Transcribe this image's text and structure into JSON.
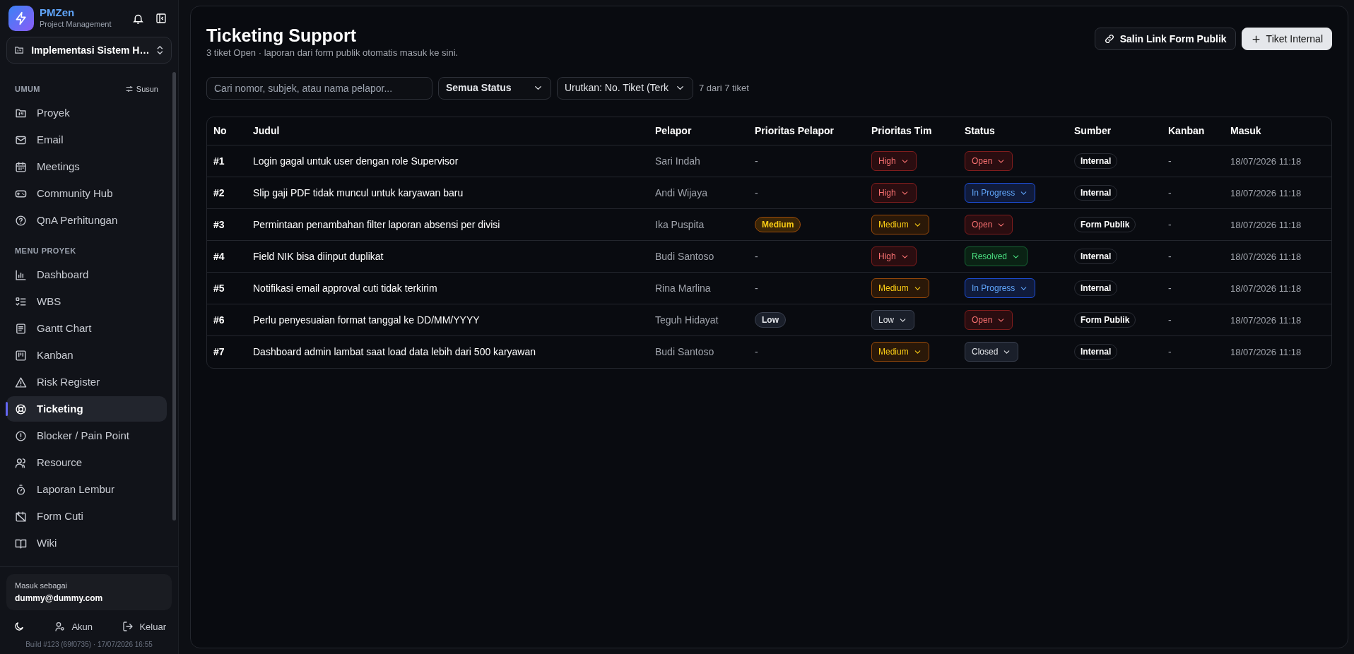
{
  "app": {
    "name": "PMZen",
    "subtitle": "Project Management"
  },
  "project_selector": {
    "value": "Implementasi Sistem H…"
  },
  "sidebar": {
    "sections": [
      {
        "title": "UMUM",
        "action": "Susun",
        "items": [
          {
            "label": "Proyek",
            "selected": false
          },
          {
            "label": "Email",
            "selected": false
          },
          {
            "label": "Meetings",
            "selected": false
          },
          {
            "label": "Community Hub",
            "selected": false
          },
          {
            "label": "QnA Perhitungan",
            "selected": false
          }
        ]
      },
      {
        "title": "MENU PROYEK",
        "items": [
          {
            "label": "Dashboard",
            "selected": false
          },
          {
            "label": "WBS",
            "selected": false
          },
          {
            "label": "Gantt Chart",
            "selected": false
          },
          {
            "label": "Kanban",
            "selected": false
          },
          {
            "label": "Risk Register",
            "selected": false
          },
          {
            "label": "Ticketing",
            "selected": true
          },
          {
            "label": "Blocker / Pain Point",
            "selected": false
          },
          {
            "label": "Resource",
            "selected": false
          },
          {
            "label": "Laporan Lembur",
            "selected": false
          },
          {
            "label": "Form Cuti",
            "selected": false
          },
          {
            "label": "Wiki",
            "selected": false
          }
        ]
      }
    ]
  },
  "user": {
    "caption": "Masuk sebagai",
    "email": "dummy@dummy.com"
  },
  "footer_actions": [
    "Akun",
    "Keluar"
  ],
  "build": "Build #123 (69f0735) · 17/07/2026 16:55",
  "page": {
    "title": "Ticketing Support",
    "subtitle": "3 tiket Open · laporan dari form publik otomatis masuk ke sini.",
    "buttons": [
      {
        "label": "Salin Link Form Publik",
        "kind": "link"
      },
      {
        "label": "Tiket Internal",
        "kind": "add"
      }
    ]
  },
  "filters": {
    "search": {
      "placeholder": "Cari nomor, subjek, atau nama pelapor..."
    },
    "status": "Semua Status",
    "sort": "Urutkan: No. Tiket (Terk",
    "count": "7 dari 7 tiket"
  },
  "table": {
    "columns": [
      "No",
      "Judul",
      "Pelapor",
      "Prioritas Pelapor",
      "Prioritas Tim",
      "Status",
      "Sumber",
      "Kanban",
      "Masuk"
    ],
    "rows": [
      {
        "no": "#1",
        "title": "Login gagal untuk user dengan role Supervisor",
        "reporter": "Sari Indah",
        "reporter_priority": {
          "kind": "none",
          "label": "-"
        },
        "team_priority": {
          "kind": "high",
          "label": "High"
        },
        "status": {
          "kind": "open",
          "label": "Open"
        },
        "source": "Internal",
        "kanban": "-",
        "date": "18/07/2026 11:18"
      },
      {
        "no": "#2",
        "title": "Slip gaji PDF tidak muncul untuk karyawan baru",
        "reporter": "Andi Wijaya",
        "reporter_priority": {
          "kind": "none",
          "label": "-"
        },
        "team_priority": {
          "kind": "high",
          "label": "High"
        },
        "status": {
          "kind": "progress",
          "label": "In Progress"
        },
        "source": "Internal",
        "kanban": "-",
        "date": "18/07/2026 11:18"
      },
      {
        "no": "#3",
        "title": "Permintaan penambahan filter laporan absensi per divisi",
        "reporter": "Ika Puspita",
        "reporter_priority": {
          "kind": "medium",
          "label": "Medium"
        },
        "team_priority": {
          "kind": "medium",
          "label": "Medium"
        },
        "status": {
          "kind": "open",
          "label": "Open"
        },
        "source": "Form Publik",
        "kanban": "-",
        "date": "18/07/2026 11:18"
      },
      {
        "no": "#4",
        "title": "Field NIK bisa diinput duplikat",
        "reporter": "Budi Santoso",
        "reporter_priority": {
          "kind": "none",
          "label": "-"
        },
        "team_priority": {
          "kind": "high",
          "label": "High"
        },
        "status": {
          "kind": "resolved",
          "label": "Resolved"
        },
        "source": "Internal",
        "kanban": "-",
        "date": "18/07/2026 11:18"
      },
      {
        "no": "#5",
        "title": "Notifikasi email approval cuti tidak terkirim",
        "reporter": "Rina Marlina",
        "reporter_priority": {
          "kind": "none",
          "label": "-"
        },
        "team_priority": {
          "kind": "medium",
          "label": "Medium"
        },
        "status": {
          "kind": "progress",
          "label": "In Progress"
        },
        "source": "Internal",
        "kanban": "-",
        "date": "18/07/2026 11:18"
      },
      {
        "no": "#6",
        "title": "Perlu penyesuaian format tanggal ke DD/MM/YYYY",
        "reporter": "Teguh Hidayat",
        "reporter_priority": {
          "kind": "low",
          "label": "Low"
        },
        "team_priority": {
          "kind": "low",
          "label": "Low"
        },
        "status": {
          "kind": "open",
          "label": "Open"
        },
        "source": "Form Publik",
        "kanban": "-",
        "date": "18/07/2026 11:18"
      },
      {
        "no": "#7",
        "title": "Dashboard admin lambat saat load data lebih dari 500 karyawan",
        "reporter": "Budi Santoso",
        "reporter_priority": {
          "kind": "none",
          "label": "-"
        },
        "team_priority": {
          "kind": "medium",
          "label": "Medium"
        },
        "status": {
          "kind": "closed",
          "label": "Closed"
        },
        "source": "Internal",
        "kanban": "-",
        "date": "18/07/2026 11:18"
      }
    ]
  }
}
